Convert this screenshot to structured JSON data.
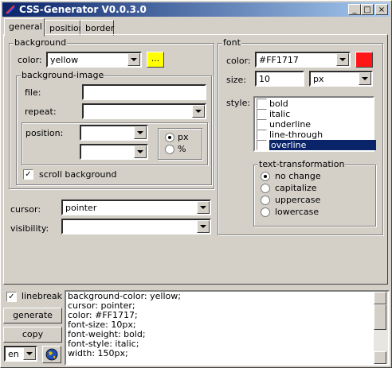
{
  "window": {
    "title": "CSS-Generator V0.0.3.0",
    "buttons": [
      "_",
      "□",
      "×"
    ]
  },
  "tabs": [
    "general",
    "position",
    "border"
  ],
  "background": {
    "legend": "background",
    "color_label": "color:",
    "color_value": "yellow",
    "swatch_color": "#ffff00",
    "swatch_button": "...",
    "image_legend": "background-image",
    "file_label": "file:",
    "file_value": "",
    "repeat_label": "repeat:",
    "repeat_value": "",
    "position_label": "position:",
    "pos_x": "",
    "pos_y": "",
    "unit_px": "px",
    "unit_pct": "%",
    "scroll_label": "scroll background"
  },
  "cursor": {
    "label": "cursor:",
    "value": "pointer"
  },
  "visibility": {
    "label": "visibility:",
    "value": ""
  },
  "font": {
    "legend": "font",
    "color_label": "color:",
    "color_value": "#FF1717",
    "swatch_color": "#ff1717",
    "size_label": "size:",
    "size_value": "10",
    "size_unit": "px",
    "style_label": "style:",
    "styles": [
      "bold",
      "italic",
      "underline",
      "line-through",
      "overline"
    ],
    "transform_legend": "text-transformation",
    "transforms": [
      "no change",
      "capitalize",
      "uppercase",
      "lowercase"
    ]
  },
  "bottom": {
    "linebreak": "linebreak",
    "generate": "generate",
    "copy": "copy",
    "lang": "en"
  },
  "output_lines": [
    "background-color: yellow;",
    "cursor: pointer;",
    "color: #FF1717;",
    "font-size: 10px;",
    "font-weight: bold;",
    "font-style: italic;",
    "width: 150px;"
  ]
}
